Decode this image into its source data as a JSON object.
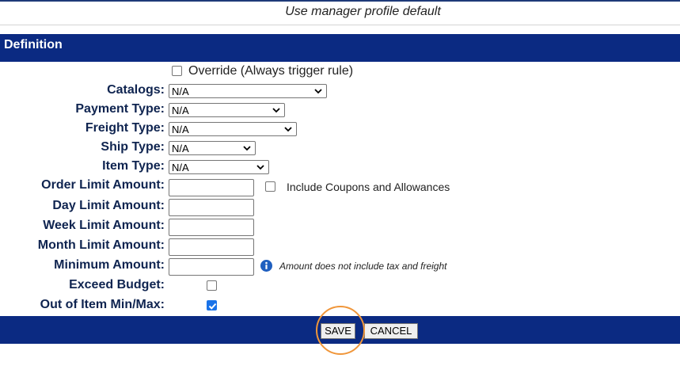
{
  "profile": {
    "note": "Use manager profile default"
  },
  "definition": {
    "title": "Definition",
    "override_label": "Override (Always trigger rule)",
    "override_checked": false,
    "fields": {
      "catalogs": {
        "label": "Catalogs:",
        "value": "N/A"
      },
      "payment_type": {
        "label": "Payment Type:",
        "value": "N/A"
      },
      "freight_type": {
        "label": "Freight Type:",
        "value": "N/A"
      },
      "ship_type": {
        "label": "Ship Type:",
        "value": "N/A"
      },
      "item_type": {
        "label": "Item Type:",
        "value": "N/A"
      },
      "order_limit": {
        "label": "Order Limit Amount:",
        "value": ""
      },
      "day_limit": {
        "label": "Day Limit Amount:",
        "value": ""
      },
      "week_limit": {
        "label": "Week Limit Amount:",
        "value": ""
      },
      "month_limit": {
        "label": "Month Limit Amount:",
        "value": ""
      },
      "minimum_amount": {
        "label": "Minimum Amount:",
        "value": ""
      },
      "exceed_budget": {
        "label": "Exceed Budget:",
        "checked": false
      },
      "out_of_item_minmax": {
        "label": "Out of Item Min/Max:",
        "checked": true
      }
    },
    "include_coupons_label": "Include Coupons and Allowances",
    "include_coupons_checked": false,
    "minimum_note": "Amount does not include tax and freight",
    "info_icon": "info-icon"
  },
  "actions": {
    "save": "SAVE",
    "cancel": "CANCEL"
  },
  "colors": {
    "bar": "#0b2a82",
    "label": "#0f2450",
    "highlight": "#f0963a",
    "check": "#1a73e8"
  }
}
